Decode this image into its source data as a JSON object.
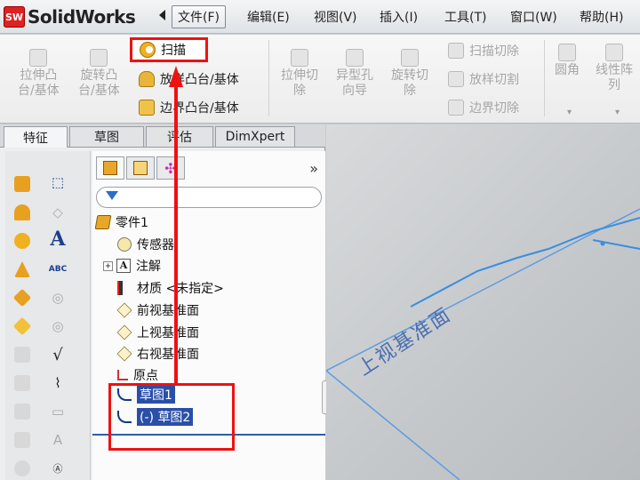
{
  "app": {
    "logo_badge": "SW",
    "logo_text": "SolidWorks"
  },
  "menu": {
    "items": [
      {
        "label": "文件(F)",
        "active": true
      },
      {
        "label": "编辑(E)"
      },
      {
        "label": "视图(V)"
      },
      {
        "label": "插入(I)"
      },
      {
        "label": "工具(T)"
      },
      {
        "label": "窗口(W)"
      },
      {
        "label": "帮助(H)"
      }
    ]
  },
  "ribbon": {
    "extrude_boss": "拉伸凸\n台/基体",
    "revolve_boss": "旋转凸\n台/基体",
    "sweep": "扫描",
    "loft_boss": "放样凸台/基体",
    "boundary_boss": "边界凸台/基体",
    "extrude_cut": "拉伸切\n除",
    "hole_wizard": "异型孔\n向导",
    "revolve_cut": "旋转切\n除",
    "sweep_cut": "扫描切除",
    "loft_cut": "放样切割",
    "boundary_cut": "边界切除",
    "fillet": "圆角",
    "linear_pattern": "线性阵\n列"
  },
  "tabs": [
    "特征",
    "草图",
    "评估",
    "DimXpert"
  ],
  "tree": {
    "collapse": "»",
    "part": "零件1",
    "items": [
      {
        "label": "传感器",
        "icon": "sensor-icon"
      },
      {
        "label": "注解",
        "icon": "annotation-icon",
        "expander": "+"
      },
      {
        "label": "材质 <未指定>",
        "icon": "material-icon"
      },
      {
        "label": "前视基准面",
        "icon": "plane-icon"
      },
      {
        "label": "上视基准面",
        "icon": "plane-icon"
      },
      {
        "label": "右视基准面",
        "icon": "plane-icon"
      },
      {
        "label": "原点",
        "icon": "origin-icon"
      }
    ],
    "sketches": [
      {
        "label": "草图1"
      },
      {
        "prefix": "(-)",
        "label": "草图2"
      }
    ]
  },
  "viewport": {
    "plane_label": "上视基准面"
  },
  "colors": {
    "highlight_red": "#ee1111",
    "selection_blue": "#2a4fa8",
    "sketch_line": "#3a8ee0"
  }
}
